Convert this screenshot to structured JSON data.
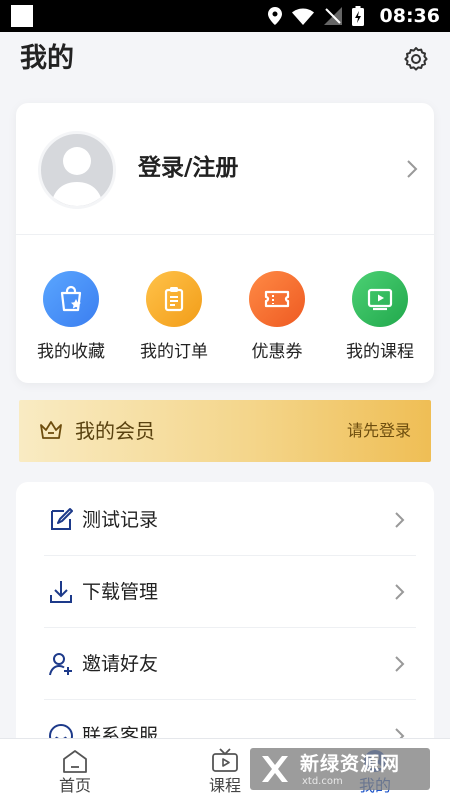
{
  "status_bar": {
    "time": "08:36"
  },
  "page": {
    "title": "我的"
  },
  "profile": {
    "login_label": "登录/注册"
  },
  "shortcuts": [
    {
      "label": "我的收藏",
      "icon": "favorites-bag-icon",
      "color": "#4a90f0"
    },
    {
      "label": "我的订单",
      "icon": "orders-clipboard-icon",
      "color": "#f5a623"
    },
    {
      "label": "优惠券",
      "icon": "coupon-ticket-icon",
      "color": "#f26a2e"
    },
    {
      "label": "我的课程",
      "icon": "course-play-icon",
      "color": "#2dbb5a"
    }
  ],
  "member": {
    "label": "我的会员",
    "action": "请先登录",
    "icon": "crown-icon"
  },
  "menu": [
    {
      "label": "测试记录",
      "icon": "edit-note-icon"
    },
    {
      "label": "下载管理",
      "icon": "download-icon"
    },
    {
      "label": "邀请好友",
      "icon": "invite-user-icon"
    },
    {
      "label": "联系客服",
      "icon": "customer-service-icon"
    }
  ],
  "bottom_nav": [
    {
      "label": "首页",
      "icon": "home-icon",
      "active": false
    },
    {
      "label": "课程",
      "icon": "tv-play-icon",
      "active": false
    },
    {
      "label": "我的",
      "icon": "profile-icon",
      "active": true
    }
  ],
  "watermark": {
    "text": "新绿资源网",
    "sub": "xtd.com"
  },
  "colors": {
    "accent": "#1f55c9",
    "member_gold": "#efbe55",
    "background": "#f4f5f8"
  }
}
